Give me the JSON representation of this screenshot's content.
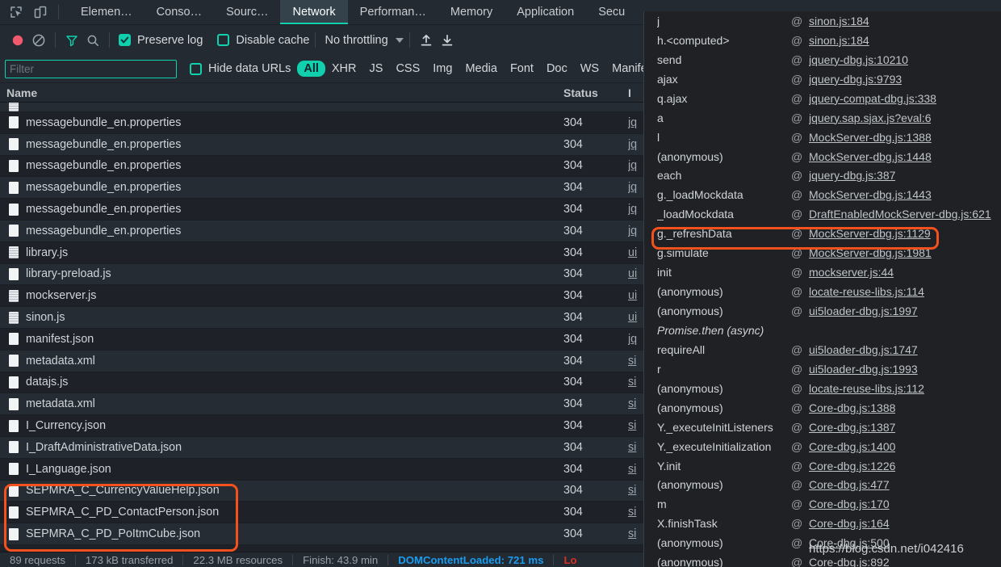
{
  "window": {
    "title": "DevTools - Network",
    "accent_teal": "#10d0ae",
    "highlight_orange": "#f4511e",
    "panel_bg": "#1e2228",
    "popup_bg": "#202124"
  },
  "tabbar": {
    "inspect_icon": "inspect-element-icon",
    "device_icon": "device-toolbar-icon",
    "tabs": [
      {
        "label": "Elemen…",
        "selected": false
      },
      {
        "label": "Conso…",
        "selected": false
      },
      {
        "label": "Sourc…",
        "selected": false
      },
      {
        "label": "Network",
        "selected": true
      },
      {
        "label": "Performan…",
        "selected": false
      },
      {
        "label": "Memory",
        "selected": false
      },
      {
        "label": "Application",
        "selected": false
      },
      {
        "label": "Secu",
        "selected": false
      }
    ]
  },
  "toolbar": {
    "record_icon": "record-button-icon",
    "clear_icon": "clear-icon",
    "filter_icon": "filter-funnel-icon",
    "search_icon": "search-icon",
    "preserve_log": {
      "label": "Preserve log",
      "checked": true
    },
    "disable_cache": {
      "label": "Disable cache",
      "checked": false
    },
    "throttling": {
      "label": "No throttling"
    },
    "import_icon": "import-har-icon",
    "export_icon": "export-har-icon"
  },
  "filterbar": {
    "filter_input": {
      "value": "",
      "placeholder": "Filter"
    },
    "hide_data_urls": {
      "label": "Hide data URLs",
      "checked": false
    },
    "types": [
      {
        "label": "All",
        "selected": true
      },
      {
        "label": "XHR",
        "selected": false
      },
      {
        "label": "JS",
        "selected": false
      },
      {
        "label": "CSS",
        "selected": false
      },
      {
        "label": "Img",
        "selected": false
      },
      {
        "label": "Media",
        "selected": false
      },
      {
        "label": "Font",
        "selected": false
      },
      {
        "label": "Doc",
        "selected": false
      },
      {
        "label": "WS",
        "selected": false
      },
      {
        "label": "Manife",
        "selected": false
      }
    ]
  },
  "table": {
    "columns": {
      "name": "Name",
      "status": "Status",
      "initiator": "I"
    },
    "rows": [
      {
        "name": "",
        "status": "",
        "initiator": "",
        "icon": "script-file-icon",
        "clipped": true,
        "highlighted": false
      },
      {
        "name": "messagebundle_en.properties",
        "status": "304",
        "initiator": "jq",
        "icon": "document-file-icon",
        "highlighted": false
      },
      {
        "name": "messagebundle_en.properties",
        "status": "304",
        "initiator": "jq",
        "icon": "document-file-icon",
        "highlighted": false
      },
      {
        "name": "messagebundle_en.properties",
        "status": "304",
        "initiator": "jq",
        "icon": "document-file-icon",
        "highlighted": false
      },
      {
        "name": "messagebundle_en.properties",
        "status": "304",
        "initiator": "jq",
        "icon": "document-file-icon",
        "highlighted": false
      },
      {
        "name": "messagebundle_en.properties",
        "status": "304",
        "initiator": "jq",
        "icon": "document-file-icon",
        "highlighted": false
      },
      {
        "name": "messagebundle_en.properties",
        "status": "304",
        "initiator": "jq",
        "icon": "document-file-icon",
        "highlighted": false
      },
      {
        "name": "library.js",
        "status": "304",
        "initiator": "ui",
        "icon": "script-file-icon",
        "highlighted": false
      },
      {
        "name": "library-preload.js",
        "status": "304",
        "initiator": "ui",
        "icon": "document-file-icon",
        "highlighted": false
      },
      {
        "name": "mockserver.js",
        "status": "304",
        "initiator": "ui",
        "icon": "script-file-icon",
        "highlighted": false
      },
      {
        "name": "sinon.js",
        "status": "304",
        "initiator": "ui",
        "icon": "script-file-icon",
        "highlighted": false
      },
      {
        "name": "manifest.json",
        "status": "304",
        "initiator": "jq",
        "icon": "document-file-icon",
        "highlighted": false
      },
      {
        "name": "metadata.xml",
        "status": "304",
        "initiator": "si",
        "icon": "document-file-icon",
        "highlighted": false
      },
      {
        "name": "datajs.js",
        "status": "304",
        "initiator": "si",
        "icon": "document-file-icon",
        "highlighted": false
      },
      {
        "name": "metadata.xml",
        "status": "304",
        "initiator": "si",
        "icon": "document-file-icon",
        "highlighted": false
      },
      {
        "name": "I_Currency.json",
        "status": "304",
        "initiator": "si",
        "icon": "document-file-icon",
        "highlighted": false
      },
      {
        "name": "I_DraftAdministrativeData.json",
        "status": "304",
        "initiator": "si",
        "icon": "document-file-icon",
        "highlighted": false
      },
      {
        "name": "I_Language.json",
        "status": "304",
        "initiator": "si",
        "icon": "document-file-icon",
        "highlighted": false
      },
      {
        "name": "SEPMRA_C_CurrencyValueHelp.json",
        "status": "304",
        "initiator": "si",
        "icon": "document-file-icon",
        "highlighted": true
      },
      {
        "name": "SEPMRA_C_PD_ContactPerson.json",
        "status": "304",
        "initiator": "si",
        "icon": "document-file-icon",
        "highlighted": true
      },
      {
        "name": "SEPMRA_C_PD_PoItmCube.json",
        "status": "304",
        "initiator": "si",
        "icon": "document-file-icon",
        "highlighted": true
      }
    ]
  },
  "statusbar": {
    "requests": "89 requests",
    "transferred": "173 kB transferred",
    "resources": "22.3 MB resources",
    "finish": "Finish: 43.9 min",
    "domcontentloaded": "DOMContentLoaded: 721 ms",
    "load": "Lo"
  },
  "callstack": {
    "frames": [
      {
        "fn": "j",
        "at": "@",
        "loc": "sinon.js:184",
        "async": false,
        "highlighted": false
      },
      {
        "fn": "h.<computed>",
        "at": "@",
        "loc": "sinon.js:184",
        "async": false,
        "highlighted": false
      },
      {
        "fn": "send",
        "at": "@",
        "loc": "jquery-dbg.js:10210",
        "async": false,
        "highlighted": false
      },
      {
        "fn": "ajax",
        "at": "@",
        "loc": "jquery-dbg.js:9793",
        "async": false,
        "highlighted": false
      },
      {
        "fn": "q.ajax",
        "at": "@",
        "loc": "jquery-compat-dbg.js:338",
        "async": false,
        "highlighted": false
      },
      {
        "fn": "a",
        "at": "@",
        "loc": "jquery.sap.sjax.js?eval:6",
        "async": false,
        "highlighted": false
      },
      {
        "fn": "l",
        "at": "@",
        "loc": "MockServer-dbg.js:1388",
        "async": false,
        "highlighted": false
      },
      {
        "fn": "(anonymous)",
        "at": "@",
        "loc": "MockServer-dbg.js:1448",
        "async": false,
        "highlighted": false
      },
      {
        "fn": "each",
        "at": "@",
        "loc": "jquery-dbg.js:387",
        "async": false,
        "highlighted": false
      },
      {
        "fn": "g._loadMockdata",
        "at": "@",
        "loc": "MockServer-dbg.js:1443",
        "async": false,
        "highlighted": false
      },
      {
        "fn": "_loadMockdata",
        "at": "@",
        "loc": "DraftEnabledMockServer-dbg.js:621",
        "async": false,
        "highlighted": false
      },
      {
        "fn": "g._refreshData",
        "at": "@",
        "loc": "MockServer-dbg.js:1129",
        "async": false,
        "highlighted": true
      },
      {
        "fn": "g.simulate",
        "at": "@",
        "loc": "MockServer-dbg.js:1981",
        "async": false,
        "highlighted": false
      },
      {
        "fn": "init",
        "at": "@",
        "loc": "mockserver.js:44",
        "async": false,
        "highlighted": false
      },
      {
        "fn": "(anonymous)",
        "at": "@",
        "loc": "locate-reuse-libs.js:114",
        "async": false,
        "highlighted": false
      },
      {
        "fn": "(anonymous)",
        "at": "@",
        "loc": "ui5loader-dbg.js:1997",
        "async": false,
        "highlighted": false
      },
      {
        "fn": "Promise.then (async)",
        "at": "",
        "loc": "",
        "async": true,
        "highlighted": false
      },
      {
        "fn": "requireAll",
        "at": "@",
        "loc": "ui5loader-dbg.js:1747",
        "async": false,
        "highlighted": false
      },
      {
        "fn": "r",
        "at": "@",
        "loc": "ui5loader-dbg.js:1993",
        "async": false,
        "highlighted": false
      },
      {
        "fn": "(anonymous)",
        "at": "@",
        "loc": "locate-reuse-libs.js:112",
        "async": false,
        "highlighted": false
      },
      {
        "fn": "(anonymous)",
        "at": "@",
        "loc": "Core-dbg.js:1388",
        "async": false,
        "highlighted": false
      },
      {
        "fn": "Y._executeInitListeners",
        "at": "@",
        "loc": "Core-dbg.js:1387",
        "async": false,
        "highlighted": false
      },
      {
        "fn": "Y._executeInitialization",
        "at": "@",
        "loc": "Core-dbg.js:1400",
        "async": false,
        "highlighted": false
      },
      {
        "fn": "Y.init",
        "at": "@",
        "loc": "Core-dbg.js:1226",
        "async": false,
        "highlighted": false
      },
      {
        "fn": "(anonymous)",
        "at": "@",
        "loc": "Core-dbg.js:477",
        "async": false,
        "highlighted": false
      },
      {
        "fn": "m",
        "at": "@",
        "loc": "Core-dbg.js:170",
        "async": false,
        "highlighted": false
      },
      {
        "fn": "X.finishTask",
        "at": "@",
        "loc": "Core-dbg.js:164",
        "async": false,
        "highlighted": false
      },
      {
        "fn": "(anonymous)",
        "at": "@",
        "loc": "Core-dbg.js:500",
        "async": false,
        "highlighted": false
      },
      {
        "fn": "(anonymous)",
        "at": "@",
        "loc": "Core-dbg.js:892",
        "async": false,
        "highlighted": false
      }
    ]
  },
  "watermark": {
    "text": "https://blog.csdn.net/i042416"
  }
}
